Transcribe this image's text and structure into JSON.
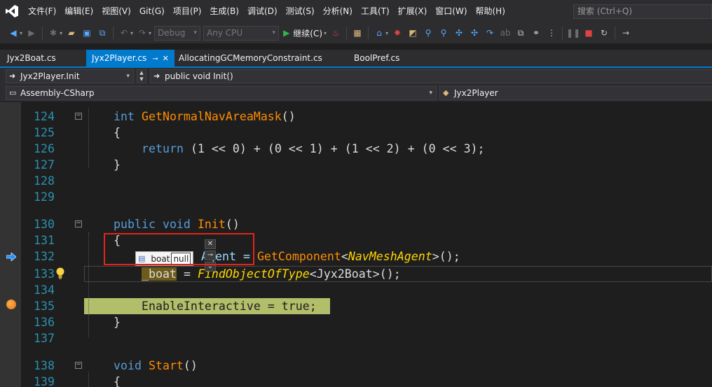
{
  "menu": {
    "items": [
      "文件(F)",
      "编辑(E)",
      "视图(V)",
      "Git(G)",
      "项目(P)",
      "生成(B)",
      "调试(D)",
      "测试(S)",
      "分析(N)",
      "工具(T)",
      "扩展(X)",
      "窗口(W)",
      "帮助(H)"
    ],
    "search_placeholder": "搜索 (Ctrl+Q)"
  },
  "toolbar": {
    "config": "Debug",
    "platform": "Any CPU",
    "continue_label": "继续(C)"
  },
  "tabs": [
    {
      "label": "Jyx2Boat.cs",
      "active": false
    },
    {
      "label": "Jyx2Player.cs",
      "active": true
    },
    {
      "label": "AllocatingGCMemoryConstraint.cs",
      "active": false
    },
    {
      "label": "BoolPref.cs",
      "active": false
    }
  ],
  "nav": {
    "member": "Jyx2Player.Init",
    "signature": "public void Init()",
    "project": "Assembly-CSharp",
    "type": "Jyx2Player"
  },
  "editor": {
    "line_numbers": [
      "124",
      "125",
      "126",
      "127",
      "128",
      "129",
      "130",
      "131",
      "132",
      "133",
      "134",
      "135",
      "136",
      "137",
      "138",
      "139"
    ],
    "lines": {
      "l124_kw": "int",
      "l124_fn": "GetNormalNavAreaMask",
      "l124_rest": "()",
      "l125": "{",
      "l126_kw": "return",
      "l126_rest": " (1 << 0) + (0 << 1) + (1 << 2) + (0 << 3);",
      "l127": "}",
      "l130_kw1": "public",
      "l130_kw2": "void",
      "l130_fn": "Init",
      "l130_rest": "()",
      "l131": "{",
      "l132_tail": "Agent = ",
      "l132_fn": "GetComponent",
      "l132_lt": "<",
      "l132_ty": "NavMeshAgent",
      "l132_gt": ">();",
      "l133_var": "_boat",
      "l133_eq": " = ",
      "l133_fn": "FindObjectOfType",
      "l133_lt": "<",
      "l133_ty": "Jyx2Boat",
      "l133_gt": ">();",
      "l135": "EnableInteractive = true;",
      "l136": "}",
      "l138_kw": "void",
      "l138_fn": "Start",
      "l138_rest": "()",
      "l139": "{"
    },
    "datatip": {
      "name": "boat",
      "value": "null"
    }
  },
  "colors": {
    "accent": "#007acc",
    "background": "#1e1e1e",
    "exec_highlight": "#c3cf72",
    "annotation_box": "#e1251b"
  }
}
